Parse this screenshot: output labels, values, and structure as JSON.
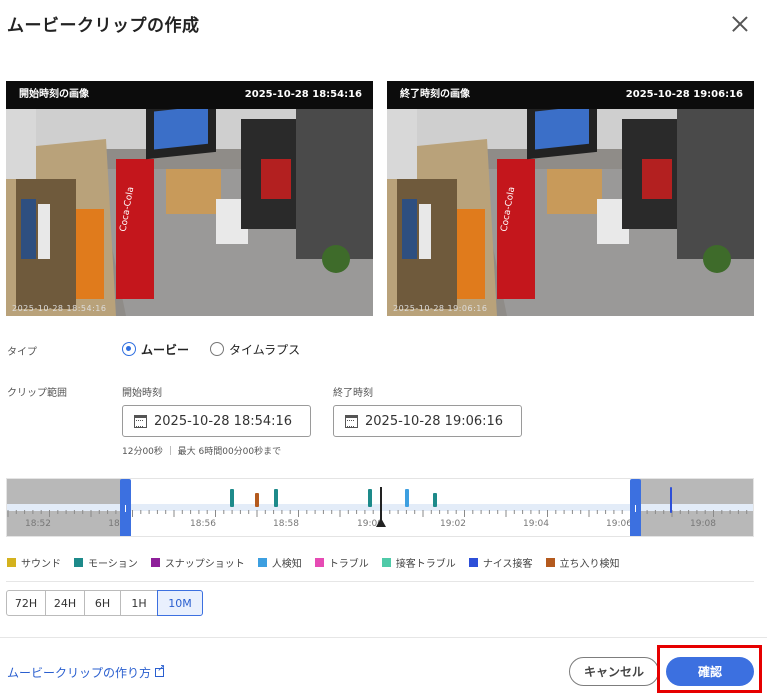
{
  "dialog": {
    "title": "ムービークリップの作成",
    "close_icon": "close-icon"
  },
  "previews": {
    "start": {
      "label": "開始時刻の画像",
      "timestamp": "2025-10-28 18:54:16",
      "camera_overlay": "2025-10-28 18:54:16"
    },
    "end": {
      "label": "終了時刻の画像",
      "timestamp": "2025-10-28 19:06:16",
      "camera_overlay": "2025-10-28 19:06:16"
    }
  },
  "type": {
    "label": "タイプ",
    "options": [
      {
        "label": "ムービー",
        "selected": true
      },
      {
        "label": "タイムラプス",
        "selected": false
      }
    ]
  },
  "clip_range": {
    "label": "クリップ範囲",
    "start_label": "開始時刻",
    "start_value": "2025-10-28 18:54:16",
    "end_label": "終了時刻",
    "end_value": "2025-10-28 19:06:16",
    "duration_note": "12分00秒 ｜ 最大 6時間00分00秒まで"
  },
  "timeline": {
    "tick_labels": [
      "18:52",
      "18",
      "18:56",
      "18:58",
      "19:00",
      "19:02",
      "19:04",
      "19:06",
      "19:08"
    ],
    "events": [
      {
        "type": "motion",
        "time": "18:56:40"
      },
      {
        "type": "favorite",
        "time": "18:57:15"
      },
      {
        "type": "motion",
        "time": "18:57:45"
      },
      {
        "type": "motion",
        "time": "18:59:55"
      },
      {
        "type": "person",
        "time": "19:00:50"
      },
      {
        "type": "motion",
        "time": "19:01:35"
      },
      {
        "type": "nice",
        "time": "19:07:15"
      }
    ]
  },
  "legend": [
    {
      "label": "サウンド",
      "color": "#d4b21e"
    },
    {
      "label": "モーション",
      "color": "#1d8a8a"
    },
    {
      "label": "スナップショット",
      "color": "#8e1f9a"
    },
    {
      "label": "人検知",
      "color": "#3d9fe0"
    },
    {
      "label": "トラブル",
      "color": "#e64bb4"
    },
    {
      "label": "接客トラブル",
      "color": "#4fcaa8"
    },
    {
      "label": "ナイス接客",
      "color": "#2d4fd8"
    },
    {
      "label": "立ち入り検知",
      "color": "#b45a1e"
    }
  ],
  "range_buttons": [
    {
      "label": "72H",
      "active": false
    },
    {
      "label": "24H",
      "active": false
    },
    {
      "label": "6H",
      "active": false
    },
    {
      "label": "1H",
      "active": false
    },
    {
      "label": "10M",
      "active": true
    }
  ],
  "footer": {
    "howto_link": "ムービークリップの作り方",
    "cancel_label": "キャンセル",
    "confirm_label": "確認"
  }
}
